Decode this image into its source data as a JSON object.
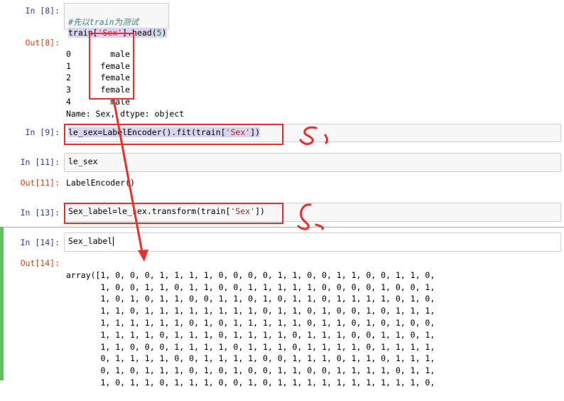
{
  "cells": [
    {
      "in_prompt": "In [8]:",
      "comment": "#先以train为测试",
      "code_a": "train[",
      "code_str": "'Sex'",
      "code_b": "].head(",
      "code_num": "5",
      "code_c": ")",
      "out_prompt": "Out[8]:",
      "out_lines": [
        "0        male",
        "1      female",
        "2      female",
        "3      female",
        "4        male",
        "Name: Sex, dtype: object"
      ]
    },
    {
      "in_prompt": "In [9]:",
      "code_a": "le_sex=LabelEncoder().fit(train[",
      "code_str": "'Sex'",
      "code_c": "])"
    },
    {
      "in_prompt": "In [11]:",
      "code": "le_sex",
      "out_prompt": "Out[11]:",
      "out_text": "LabelEncoder()"
    },
    {
      "in_prompt": "In [13]:",
      "code_a": "Sex_label=le_sex.transform(train[",
      "code_str": "'Sex'",
      "code_c": "])"
    },
    {
      "in_prompt": "In [14]:",
      "code": "Sex_label",
      "out_prompt": "Out[14]:",
      "out_lines": [
        "array([1, 0, 0, 0, 1, 1, 1, 1, 0, 0, 0, 0, 1, 1, 0, 0, 1, 1, 0, 0, 1, 1, 0,",
        "       1, 0, 0, 1, 1, 0, 1, 1, 0, 0, 1, 1, 1, 1, 1, 0, 0, 0, 0, 1, 0, 0, 1,",
        "       1, 0, 1, 0, 1, 1, 0, 0, 1, 1, 0, 1, 0, 1, 1, 0, 1, 1, 1, 1, 0, 1, 0,",
        "       1, 1, 0, 1, 1, 1, 1, 1, 1, 1, 1, 0, 1, 1, 0, 1, 0, 0, 1, 0, 1, 1, 1,",
        "       1, 1, 1, 1, 1, 1, 0, 1, 0, 1, 1, 1, 1, 1, 0, 1, 1, 0, 1, 0, 1, 0, 0,",
        "       1, 1, 1, 1, 0, 1, 1, 1, 0, 1, 1, 1, 1, 0, 1, 1, 1, 0, 0, 1, 1, 0, 1,",
        "       1, 1, 0, 0, 0, 1, 1, 1, 1, 0, 1, 1, 1, 0, 1, 1, 1, 1, 0, 1, 1, 1, 1,",
        "       0, 1, 1, 1, 1, 0, 0, 1, 1, 1, 1, 0, 0, 1, 1, 1, 0, 1, 1, 0, 1, 1, 1,",
        "       0, 1, 0, 1, 1, 1, 0, 1, 0, 1, 0, 0, 1, 1, 0, 0, 1, 1, 1, 1, 0, 1, 1,",
        "       1, 0, 1, 1, 0, 1, 1, 1, 0, 0, 1, 0, 1, 1, 1, 1, 1, 1, 1, 1, 1, 1, 0,"
      ]
    }
  ]
}
